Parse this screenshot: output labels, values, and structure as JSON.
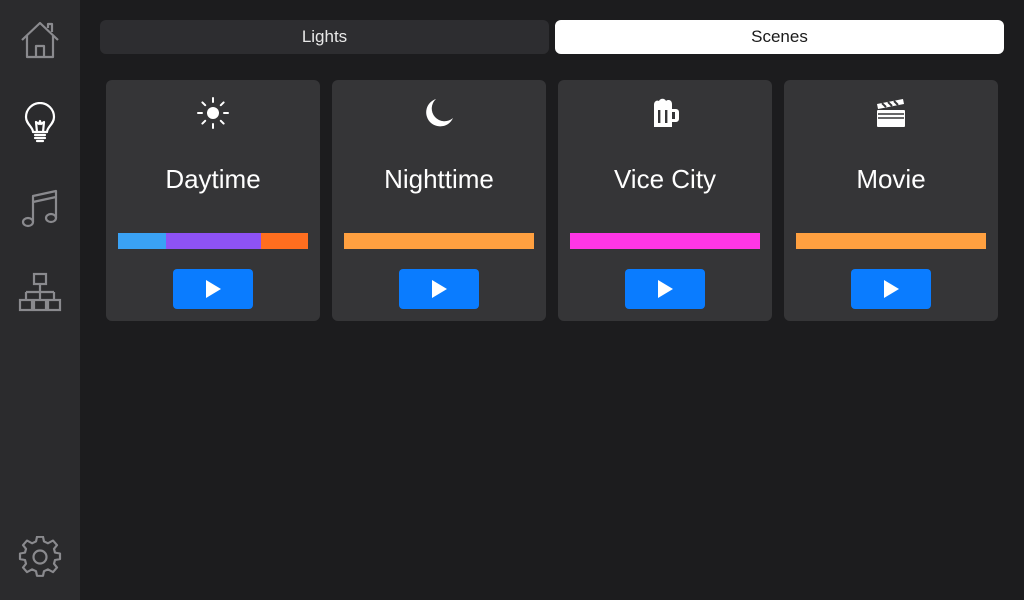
{
  "sidebar": {
    "items": [
      {
        "name": "home",
        "icon": "home-icon",
        "color": "#8a8a8e"
      },
      {
        "name": "lights",
        "icon": "lightbulb-icon",
        "color": "#ffffff",
        "active": true
      },
      {
        "name": "music",
        "icon": "music-note-icon",
        "color": "#8a8a8e"
      },
      {
        "name": "network",
        "icon": "network-tree-icon",
        "color": "#8a8a8e"
      },
      {
        "name": "settings",
        "icon": "gear-icon",
        "color": "#8a8a8e"
      }
    ]
  },
  "tabs": {
    "lights_label": "Lights",
    "scenes_label": "Scenes",
    "active": "Scenes"
  },
  "scenes": [
    {
      "name": "Daytime",
      "icon": "sun-icon",
      "colors": [
        {
          "hex": "#3aa2f5",
          "share": 0.25
        },
        {
          "hex": "#8e52f5",
          "share": 0.5
        },
        {
          "hex": "#ff6e1f",
          "share": 0.25
        }
      ]
    },
    {
      "name": "Nighttime",
      "icon": "moon-icon",
      "colors": [
        {
          "hex": "#ffa040",
          "share": 1
        }
      ]
    },
    {
      "name": "Vice City",
      "icon": "beer-mug-icon",
      "colors": [
        {
          "hex": "#ff36e6",
          "share": 1
        }
      ]
    },
    {
      "name": "Movie",
      "icon": "clapperboard-icon",
      "colors": [
        {
          "hex": "#ffa040",
          "share": 1
        }
      ]
    }
  ],
  "colors": {
    "accent": "#0a7cff",
    "background": "#1c1c1e",
    "sidebar": "#2b2b2d",
    "card": "#353537"
  }
}
